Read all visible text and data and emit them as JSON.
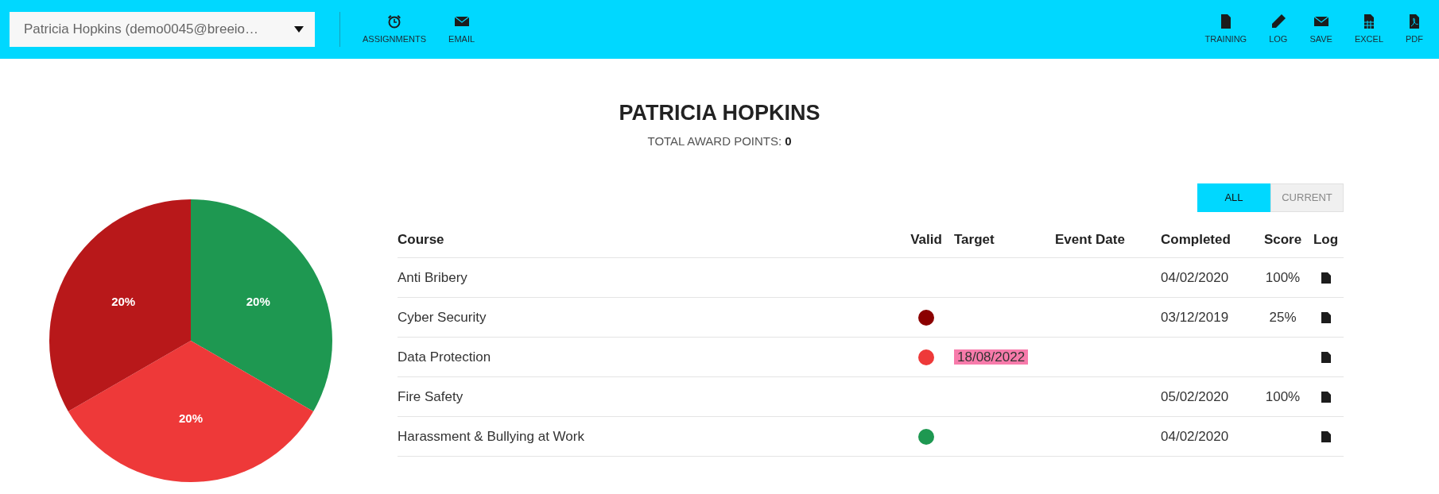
{
  "toolbar": {
    "user_select": {
      "value": "Patricia Hopkins (demo0045@breeio…"
    },
    "left_actions": [
      {
        "label": "ASSIGNMENTS",
        "kind": "alarm"
      },
      {
        "label": "EMAIL",
        "kind": "mail"
      }
    ],
    "right_actions": [
      {
        "label": "TRAINING",
        "kind": "file"
      },
      {
        "label": "LOG",
        "kind": "pencil"
      },
      {
        "label": "SAVE",
        "kind": "mail"
      },
      {
        "label": "EXCEL",
        "kind": "sheet"
      },
      {
        "label": "PDF",
        "kind": "pdf"
      }
    ]
  },
  "header": {
    "name": "PATRICIA HOPKINS",
    "points_label": "TOTAL AWARD POINTS:",
    "points_value": "0"
  },
  "chart": {
    "chart_data": {
      "type": "pie",
      "values": [
        20,
        20,
        20
      ],
      "value_labels": [
        "20%",
        "20%",
        "20%"
      ]
    }
  },
  "filter_tabs": [
    {
      "label": "ALL",
      "selected": true
    },
    {
      "label": "CURRENT",
      "selected": false
    }
  ],
  "table": {
    "columns": [
      "Course",
      "Valid",
      "Target",
      "Event Date",
      "Completed",
      "Score",
      "Log"
    ],
    "rows": [
      {
        "course": "Anti Bribery",
        "color": null,
        "target": null,
        "event_date": null,
        "completed": "04/02/2020",
        "score": "100%"
      },
      {
        "course": "Cyber Security",
        "color": "#8b0000",
        "target": null,
        "event_date": null,
        "completed": "03/12/2019",
        "score": "25%"
      },
      {
        "course": "Data Protection",
        "color": "#ee3939",
        "target": "18/08/2022",
        "event_date": null,
        "completed": null,
        "score": null
      },
      {
        "course": "Fire Safety",
        "color": null,
        "target": null,
        "event_date": null,
        "completed": "05/02/2020",
        "score": "100%"
      },
      {
        "course": "Harassment & Bullying at Work",
        "color": "#1e9851",
        "target": null,
        "event_date": null,
        "completed": "04/02/2020",
        "score": null
      }
    ]
  }
}
